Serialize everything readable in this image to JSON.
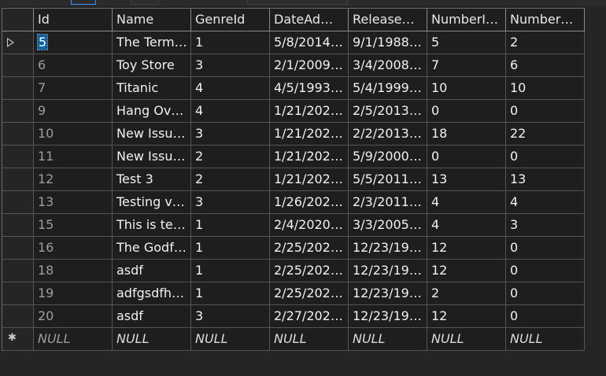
{
  "columns": [
    "Id",
    "Name",
    "GenreId",
    "DateAd…",
    "Release…",
    "NumberI…",
    "Number…"
  ],
  "rows": [
    [
      "5",
      "The Termi…",
      "1",
      "5/8/2014…",
      "9/1/1988…",
      "5",
      "2"
    ],
    [
      "6",
      "Toy Store",
      "3",
      "2/1/2009…",
      "3/4/2008…",
      "7",
      "6"
    ],
    [
      "7",
      "Titanic",
      "4",
      "4/5/1993…",
      "5/4/1999…",
      "10",
      "10"
    ],
    [
      "9",
      "Hang Ov…",
      "4",
      "1/21/202…",
      "2/5/2013…",
      "0",
      "0"
    ],
    [
      "10",
      "New Issu…",
      "3",
      "1/21/202…",
      "2/2/2013…",
      "18",
      "22"
    ],
    [
      "11",
      "New Issu…",
      "2",
      "1/21/202…",
      "5/9/2000…",
      "0",
      "0"
    ],
    [
      "12",
      "Test 3",
      "2",
      "1/21/202…",
      "5/5/2011…",
      "13",
      "13"
    ],
    [
      "13",
      "Testing v…",
      "3",
      "1/26/202…",
      "2/3/2011…",
      "4",
      "4"
    ],
    [
      "15",
      "This is te…",
      "1",
      "2/4/2020…",
      "3/3/2005…",
      "4",
      "3"
    ],
    [
      "16",
      "The Godf…",
      "1",
      "2/25/202…",
      "12/23/19…",
      "12",
      "0"
    ],
    [
      "18",
      "asdf",
      "1",
      "2/25/202…",
      "12/23/19…",
      "12",
      "0"
    ],
    [
      "19",
      "adfgsdfh…",
      "1",
      "2/25/202…",
      "12/23/19…",
      "2",
      "0"
    ],
    [
      "20",
      "asdf",
      "3",
      "2/27/202…",
      "12/23/19…",
      "12",
      "0"
    ]
  ],
  "new_row": [
    "NULL",
    "NULL",
    "NULL",
    "NULL",
    "NULL",
    "NULL",
    "NULL"
  ],
  "colors": {
    "grid_background": "#1e1e1e",
    "selection": "#0e639c",
    "text": "#f1f1f1",
    "id_text": "#9d9d9d"
  }
}
